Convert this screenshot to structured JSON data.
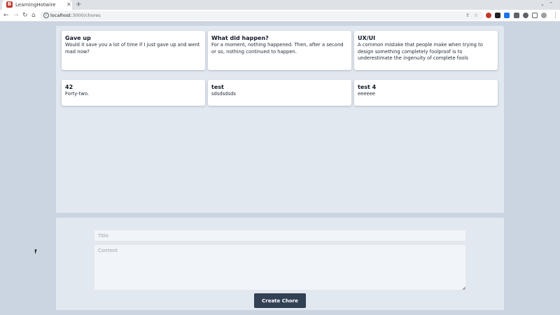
{
  "browser": {
    "tab_title": "LearningHotwire",
    "favicon_letter": "B",
    "tab_close": "✕",
    "new_tab": "+",
    "url_host": "localhost",
    "url_path": ":3000/chores",
    "icons": {
      "back": "←",
      "forward": "→",
      "reload": "↻",
      "home": "⌂",
      "share": "⇪",
      "star": "☆",
      "menu": "⋮",
      "chevron": "⌄",
      "minimize": "–"
    }
  },
  "chores": [
    {
      "title": "Gave up",
      "content": "Would it save you a lot of time if I just gave up and went mad now?"
    },
    {
      "title": "What did happen?",
      "content": "For a moment, nothing happened. Then, after a second or so, nothing continued to happen."
    },
    {
      "title": "UX/UI",
      "content": "A common mistake that people make when trying to design something completely foolproof is to underestimate the ingenuity of complete fools"
    },
    {
      "title": "42",
      "content": "Forty-two."
    },
    {
      "title": "test",
      "content": "sdsdsdsds"
    },
    {
      "title": "test 4",
      "content": "eeeeee"
    }
  ],
  "form": {
    "title_placeholder": "Title",
    "content_placeholder": "Content",
    "submit_label": "Create Chore"
  }
}
